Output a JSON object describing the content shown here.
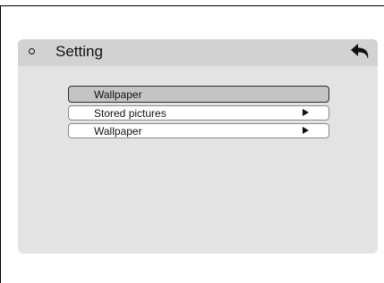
{
  "header": {
    "title": "Setting",
    "back_icon": "back-arrow-icon",
    "bullet_icon": "circle-bullet-icon"
  },
  "menu": {
    "items": [
      {
        "label": "Wallpaper",
        "selected": true,
        "has_arrow": false
      },
      {
        "label": "Stored pictures",
        "selected": false,
        "has_arrow": true
      },
      {
        "label": "Wallpaper",
        "selected": false,
        "has_arrow": true
      }
    ]
  },
  "colors": {
    "dialog_bg": "#e3e3e3",
    "header_bg": "#d2d2d2",
    "selected_bg": "#c4c4c4"
  }
}
